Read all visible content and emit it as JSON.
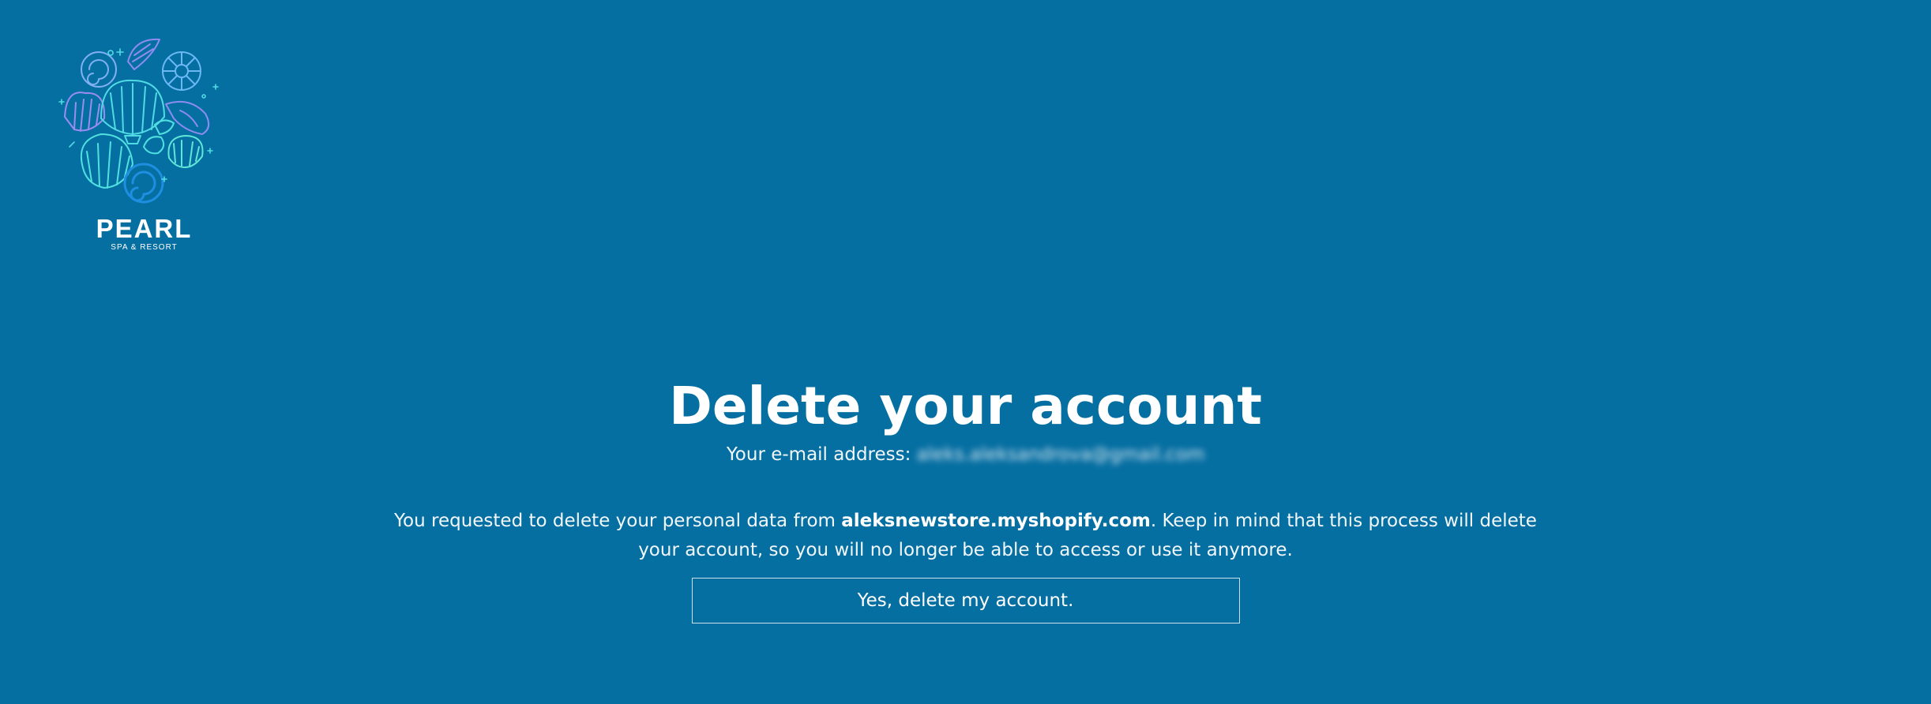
{
  "brand": {
    "name": "PEARL",
    "tagline": "SPA & RESORT",
    "logo_icon": "seashells-logo-icon"
  },
  "main": {
    "title": "Delete your account",
    "email_label": "Your e-mail address:",
    "email_value": "aleks.aleksandrova@gmail.com",
    "description_before": "You requested to delete your personal data from ",
    "store_name": "aleksnewstore.myshopify.com",
    "description_after": ". Keep in mind that this process will delete your account, so you will no longer be able to access or use it anymore.",
    "confirm_button_label": "Yes, delete my account."
  },
  "colors": {
    "background": "#066fa2",
    "text": "#ffffff",
    "logo_cyan": "#4fe0e0",
    "logo_violet": "#8d8cf0",
    "logo_blue": "#1e8fe0"
  }
}
